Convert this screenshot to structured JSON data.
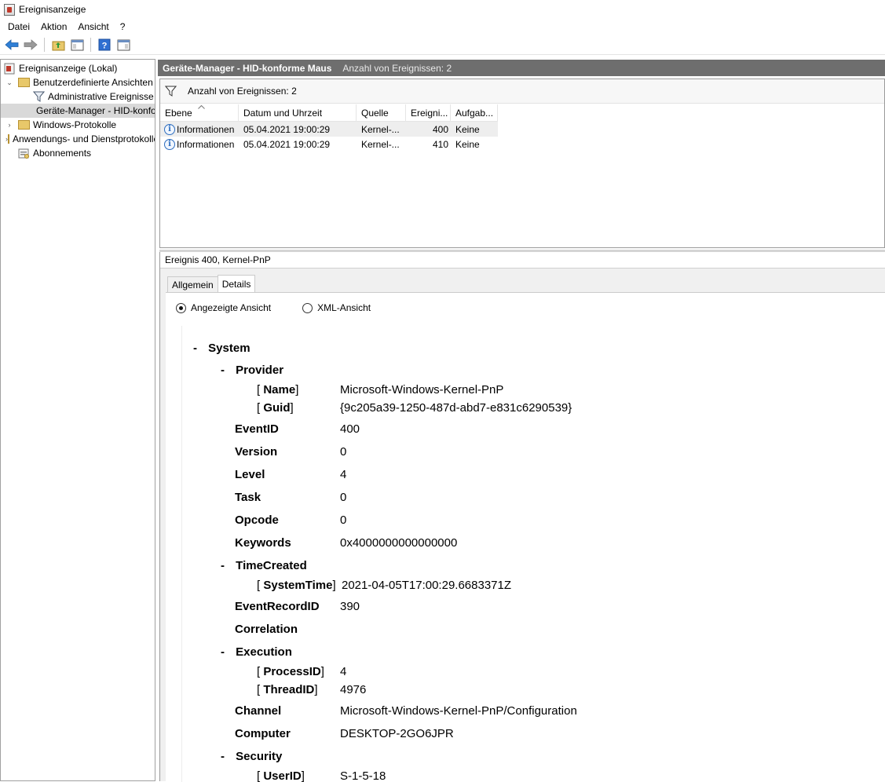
{
  "window": {
    "title": "Ereignisanzeige"
  },
  "menu": [
    "Datei",
    "Aktion",
    "Ansicht",
    "?"
  ],
  "tree": [
    {
      "label": "Ereignisanzeige (Lokal)",
      "level": 0,
      "expander": "",
      "icon": "event-viewer-icon"
    },
    {
      "label": "Benutzerdefinierte Ansichten",
      "level": 1,
      "expander": "⌄",
      "icon": "folder-icon"
    },
    {
      "label": "Administrative Ereignisse",
      "level": 2,
      "expander": "",
      "icon": "filter-icon"
    },
    {
      "label": "Geräte-Manager - HID-konforme Maus",
      "level": 2,
      "expander": "",
      "icon": "filter-icon",
      "selected": true
    },
    {
      "label": "Windows-Protokolle",
      "level": 1,
      "expander": "›",
      "icon": "folder-icon"
    },
    {
      "label": "Anwendungs- und Dienstprotokolle",
      "level": 1,
      "expander": "›",
      "icon": "folder-icon"
    },
    {
      "label": "Abonnements",
      "level": 1,
      "expander": "",
      "icon": "subscription-icon"
    }
  ],
  "panel": {
    "title": "Geräte-Manager - HID-konforme Maus",
    "count_label": "Anzahl von Ereignissen: 2",
    "filter_label": "Anzahl von Ereignissen: 2"
  },
  "columns": [
    "Ebene",
    "Datum und Uhrzeit",
    "Quelle",
    "Ereigni...",
    "Aufgab..."
  ],
  "events": [
    {
      "level": "Informationen",
      "datetime": "05.04.2021 19:00:29",
      "source": "Kernel-...",
      "id": "400",
      "task": "Keine"
    },
    {
      "level": "Informationen",
      "datetime": "05.04.2021 19:00:29",
      "source": "Kernel-...",
      "id": "410",
      "task": "Keine"
    }
  ],
  "detail": {
    "header": "Ereignis 400, Kernel-PnP",
    "tabs": [
      "Allgemein",
      "Details"
    ],
    "radio_friendly": "Angezeigte Ansicht",
    "radio_xml": "XML-Ansicht"
  },
  "xml": {
    "system": "System",
    "provider": "Provider",
    "name_key": "Name",
    "name_val": "Microsoft-Windows-Kernel-PnP",
    "guid_key": "Guid",
    "guid_val": "{9c205a39-1250-487d-abd7-e831c6290539}",
    "eventid_key": "EventID",
    "eventid_val": "400",
    "version_key": "Version",
    "version_val": "0",
    "level_key": "Level",
    "level_val": "4",
    "task_key": "Task",
    "task_val": "0",
    "opcode_key": "Opcode",
    "opcode_val": "0",
    "keywords_key": "Keywords",
    "keywords_val": "0x4000000000000000",
    "timecreated": "TimeCreated",
    "systemtime_key": "SystemTime",
    "systemtime_val": "2021-04-05T17:00:29.6683371Z",
    "recordid_key": "EventRecordID",
    "recordid_val": "390",
    "correlation": "Correlation",
    "execution": "Execution",
    "processid_key": "ProcessID",
    "processid_val": "4",
    "threadid_key": "ThreadID",
    "threadid_val": "4976",
    "channel_key": "Channel",
    "channel_val": "Microsoft-Windows-Kernel-PnP/Configuration",
    "computer_key": "Computer",
    "computer_val": "DESKTOP-2GO6JPR",
    "security": "Security",
    "userid_key": "UserID",
    "userid_val": "S-1-5-18"
  }
}
